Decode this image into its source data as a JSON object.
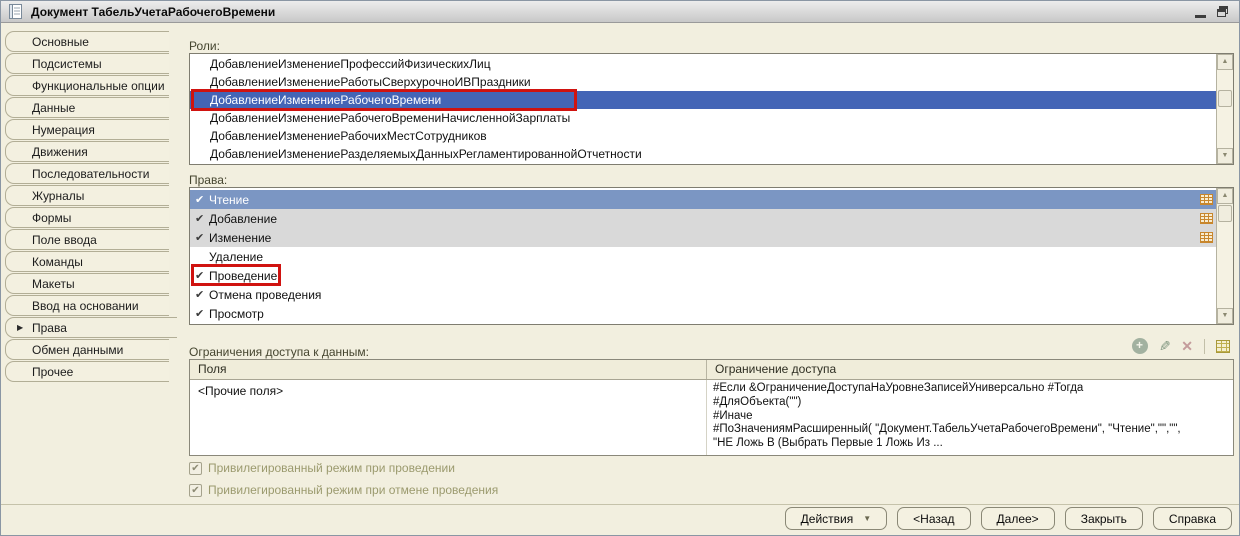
{
  "window": {
    "title": "Документ ТабельУчетаРабочегоВремени",
    "controls": {
      "minimize": "minimize",
      "restore": "restore"
    }
  },
  "sidebar": {
    "tabs": [
      {
        "label": "Основные",
        "active": false
      },
      {
        "label": "Подсистемы",
        "active": false
      },
      {
        "label": "Функциональные опции",
        "active": false
      },
      {
        "label": "Данные",
        "active": false
      },
      {
        "label": "Нумерация",
        "active": false
      },
      {
        "label": "Движения",
        "active": false
      },
      {
        "label": "Последовательности",
        "active": false
      },
      {
        "label": "Журналы",
        "active": false
      },
      {
        "label": "Формы",
        "active": false
      },
      {
        "label": "Поле ввода",
        "active": false
      },
      {
        "label": "Команды",
        "active": false
      },
      {
        "label": "Макеты",
        "active": false
      },
      {
        "label": "Ввод на основании",
        "active": false
      },
      {
        "label": "Права",
        "active": true
      },
      {
        "label": "Обмен данными",
        "active": false
      },
      {
        "label": "Прочее",
        "active": false
      }
    ],
    "active_marker": "▶"
  },
  "roles": {
    "label": "Роли:",
    "selected_index": 2,
    "annotated_index": 2,
    "items": [
      "ДобавлениеИзменениеПрофессийФизическихЛиц",
      "ДобавлениеИзменениеРаботыСверхурочноИВПраздники",
      "ДобавлениеИзменениеРабочегоВремени",
      "ДобавлениеИзменениеРабочегоВремениНачисленнойЗарплаты",
      "ДобавлениеИзменениеРабочихМестСотрудников",
      "ДобавлениеИзменениеРазделяемыхДанныхРегламентированнойОтчетности"
    ]
  },
  "rights": {
    "label": "Права:",
    "check_glyph": "✔",
    "items": [
      {
        "label": "Чтение",
        "checked": true,
        "style": "selected",
        "restriction_icon": true,
        "annotated": false
      },
      {
        "label": "Добавление",
        "checked": true,
        "style": "gray",
        "restriction_icon": true,
        "annotated": false
      },
      {
        "label": "Изменение",
        "checked": true,
        "style": "gray",
        "restriction_icon": true,
        "annotated": false
      },
      {
        "label": "Удаление",
        "checked": false,
        "style": "normal",
        "restriction_icon": false,
        "annotated": false
      },
      {
        "label": "Проведение",
        "checked": true,
        "style": "normal",
        "restriction_icon": false,
        "annotated": true
      },
      {
        "label": "Отмена проведения",
        "checked": true,
        "style": "normal",
        "restriction_icon": false,
        "annotated": false
      },
      {
        "label": "Просмотр",
        "checked": true,
        "style": "normal",
        "restriction_icon": false,
        "annotated": false
      }
    ]
  },
  "restrictions": {
    "label": "Ограничения доступа к данным:",
    "toolbar": {
      "add": "+",
      "edit": "✎",
      "delete": "✕",
      "templates": "restriction-templates"
    },
    "table": {
      "headers": {
        "fields": "Поля",
        "restriction": "Ограничение доступа"
      },
      "row": {
        "fields": "<Прочие поля>",
        "restriction_lines": [
          "#Если &ОграничениеДоступаНаУровнеЗаписейУниверсально #Тогда",
          "#ДляОбъекта(\"\")",
          "#Иначе",
          "#ПоЗначениямРасширенный( \"Документ.ТабельУчетаРабочегоВремени\", \"Чтение\",\"\",\"\",",
          "\"НЕ Ложь В (Выбрать Первые 1 Ложь Из ..."
        ]
      }
    }
  },
  "checkboxes": [
    {
      "label": "Привилегированный режим при проведении",
      "checked": true,
      "disabled": true
    },
    {
      "label": "Привилегированный режим при отмене проведения",
      "checked": true,
      "disabled": true
    }
  ],
  "footer": {
    "buttons": [
      {
        "label": "Действия",
        "dropdown": true
      },
      {
        "label": "<Назад",
        "dropdown": false
      },
      {
        "label": "Далее>",
        "dropdown": false
      },
      {
        "label": "Закрыть",
        "dropdown": false
      },
      {
        "label": "Справка",
        "dropdown": false
      }
    ]
  },
  "colors": {
    "background": "#f2efdf",
    "selection_blue": "#4465b6",
    "inactive_selection_blue": "#7b96c3",
    "gray_row": "#d9d9d9",
    "annotation_red": "#d01310",
    "restriction_icon_orange": "#c8862c",
    "disabled_text": "#9b9a6e"
  }
}
